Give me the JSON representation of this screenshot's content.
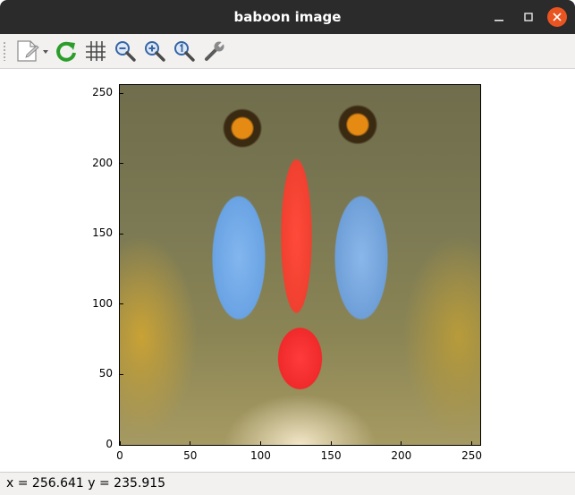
{
  "window": {
    "title": "baboon image",
    "controls": [
      "minimize-icon",
      "maximize-icon",
      "close-icon"
    ]
  },
  "toolbar": {
    "tools": [
      {
        "icon": "export-document-icon",
        "has_dropdown": true
      },
      {
        "icon": "refresh-icon"
      },
      {
        "icon": "grid-icon"
      },
      {
        "icon": "zoom-out-icon"
      },
      {
        "icon": "zoom-in-icon"
      },
      {
        "icon": "zoom-reset-icon"
      },
      {
        "icon": "settings-wrench-icon"
      }
    ]
  },
  "plot": {
    "image_name": "baboon",
    "x_ticks": [
      "0",
      "50",
      "100",
      "150",
      "200",
      "250"
    ],
    "y_ticks": [
      "250",
      "200",
      "150",
      "100",
      "50",
      "0"
    ],
    "x_range": [
      0,
      256
    ],
    "y_range": [
      0,
      256
    ]
  },
  "status": {
    "text": "x = 256.641 y = 235.915"
  },
  "colors": {
    "titlebar": "#2b2b2b",
    "close_button": "#e95420",
    "toolbar": "#f2f1f0",
    "refresh_green": "#2a9d2a",
    "zoom_blue": "#3465a4"
  }
}
